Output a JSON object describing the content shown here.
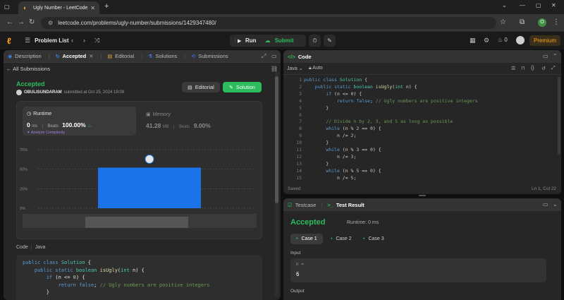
{
  "browser": {
    "tab_title": "Ugly Number - LeetCode",
    "url": "leetcode.com/problems/ugly-number/submissions/1429347480/",
    "profile_initial": "O"
  },
  "header": {
    "problem_list": "Problem List",
    "run_label": "Run",
    "submit_label": "Submit",
    "streak_count": "0",
    "premium_label": "Premium"
  },
  "left_tabs": [
    {
      "label": "Description"
    },
    {
      "label": "Accepted"
    },
    {
      "label": "Editorial"
    },
    {
      "label": "Solutions"
    },
    {
      "label": "Submissions"
    }
  ],
  "submission": {
    "back_label": "All Submissions",
    "status": "Accepted",
    "username": "OBULISUNDARAM",
    "submitted_text": "submitted at Oct 25, 2024 19:08",
    "editorial_btn": "Editorial",
    "solution_btn": "Solution"
  },
  "runtime": {
    "label": "Runtime",
    "value": "0",
    "unit": "ms",
    "sep": "|",
    "beats_label": "Beats",
    "beats_value": "100.00%",
    "analyze_label": "Analyze Complexity"
  },
  "memory": {
    "label": "Memory",
    "value": "41.28",
    "unit": "MB",
    "sep": "|",
    "beats_label": "Beats",
    "beats_value": "9.00%"
  },
  "chart_data": {
    "type": "bar",
    "y_ticks": [
      "75%",
      "50%",
      "25%",
      "0%"
    ],
    "ylim": [
      0,
      75
    ],
    "values": [
      52
    ],
    "grid": true
  },
  "code_section": {
    "label": "Code",
    "lang": "Java",
    "lines": [
      "public class Solution {",
      "    public static boolean isUgly(int n) {",
      "        if (n <= 0) {",
      "            return false; // Ugly numbers are positive integers",
      "        }"
    ]
  },
  "editor": {
    "title": "Code",
    "language": "Java",
    "mode": "Auto",
    "line_numbers": [
      "1",
      "2",
      "3",
      "4",
      "5",
      "6",
      "7",
      "8",
      "9",
      "10",
      "11",
      "12",
      "13",
      "14",
      "15"
    ],
    "lines": [
      "public class Solution {",
      "    public static boolean isUgly(int n) {",
      "        if (n <= 0) {",
      "            return false; // Ugly numbers are positive integers",
      "        }",
      "",
      "        // Divide n by 2, 3, and 5 as long as possible",
      "        while (n % 2 == 0) {",
      "            n /= 2;",
      "        }",
      "        while (n % 3 == 0) {",
      "            n /= 3;",
      "        }",
      "        while (n % 5 == 0) {",
      "            n /= 5;"
    ],
    "saved_label": "Saved",
    "cursor_pos": "Ln 1, Col 22"
  },
  "result": {
    "tab_testcase": "Testcase",
    "tab_result": "Test Result",
    "status": "Accepted",
    "runtime_text": "Runtime: 0 ms",
    "cases": [
      "Case 1",
      "Case 2",
      "Case 3"
    ],
    "input_label": "Input",
    "var_name": "n =",
    "var_value": "6",
    "output_label": "Output"
  }
}
